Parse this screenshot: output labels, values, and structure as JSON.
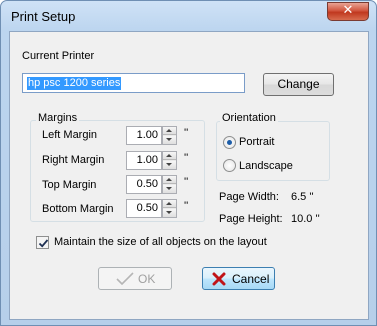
{
  "window": {
    "title": "Print Setup",
    "close_glyph": "✕"
  },
  "printer": {
    "section_label": "Current Printer",
    "name": "hp psc 1200 series",
    "change_label": "Change"
  },
  "margins": {
    "group_label": "Margins",
    "unit": "''",
    "rows": [
      {
        "label": "Left Margin",
        "value": "1.00"
      },
      {
        "label": "Right Margin",
        "value": "1.00"
      },
      {
        "label": "Top Margin",
        "value": "0.50"
      },
      {
        "label": "Bottom Margin",
        "value": "0.50"
      }
    ]
  },
  "orientation": {
    "group_label": "Orientation",
    "options": [
      {
        "label": "Portrait",
        "checked": true
      },
      {
        "label": "Landscape",
        "checked": false
      }
    ]
  },
  "page": {
    "width_label": "Page Width:",
    "width_value": "6.5 ''",
    "height_label": "Page Height:",
    "height_value": "10.0 ''"
  },
  "maintain": {
    "label": "Maintain the size of all objects on the layout",
    "checked": true
  },
  "buttons": {
    "ok_label": "OK",
    "cancel_label": "Cancel"
  },
  "colors": {
    "selection": "#3399ff",
    "close": "#c7432c",
    "cancel_icon": "#c0141a",
    "ok_icon_disabled": "#b5b5b5"
  },
  "icons": {
    "ok": "check-icon",
    "cancel": "x-icon",
    "close": "close-icon"
  }
}
